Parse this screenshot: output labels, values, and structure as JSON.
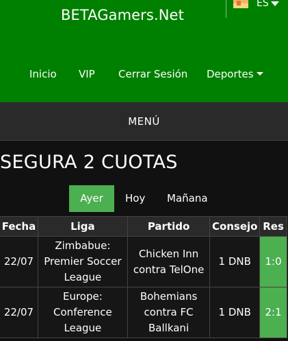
{
  "header": {
    "brand": "BETAGamers.Net",
    "language": "ES",
    "nav": [
      "Inicio",
      "VIP",
      "Cerrar Sesión",
      "Deportes"
    ]
  },
  "menu": {
    "label": "MENÚ"
  },
  "section": {
    "title": "SEGURA 2 CUOTAS"
  },
  "tabs": {
    "items": [
      "Ayer",
      "Hoy",
      "Mañana"
    ],
    "active": "Ayer"
  },
  "table": {
    "headers": [
      "Fecha",
      "Liga",
      "Partido",
      "Consejo",
      "Res"
    ],
    "rows": [
      {
        "fecha": "22/07",
        "liga": "Zimbabue: Premier Soccer League",
        "partido": "Chicken Inn contra TelOne",
        "consejo": "1 DNB",
        "res": "1:0"
      },
      {
        "fecha": "22/07",
        "liga": "Europe: Conference League",
        "partido": "Bohemians contra FC Ballkani",
        "consejo": "1 DNB",
        "res": "2:1"
      }
    ]
  },
  "colors": {
    "header_bg": "#008000",
    "accent": "#4caf50",
    "menubar_bg": "#2a2a2a",
    "page_bg": "#111111"
  },
  "icons": {
    "flag": "spain-flag-icon",
    "lang_caret": "chevron-down-icon",
    "deportes_caret": "chevron-down-icon"
  }
}
